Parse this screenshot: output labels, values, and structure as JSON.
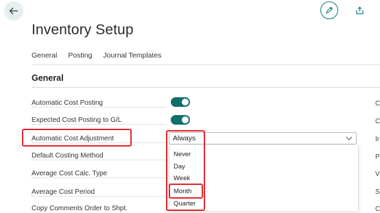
{
  "page": {
    "title": "Inventory Setup"
  },
  "nav": {
    "tabs": [
      "General",
      "Posting",
      "Journal Templates"
    ]
  },
  "section": {
    "title": "General"
  },
  "fields": {
    "automatic_cost_posting": {
      "label": "Automatic Cost Posting",
      "value": true
    },
    "expected_cost_posting": {
      "label": "Expected Cost Posting to G/L",
      "value": true
    },
    "automatic_cost_adjustment": {
      "label": "Automatic Cost Adjustment",
      "value": "Always"
    },
    "default_costing_method": {
      "label": "Default Costing Method"
    },
    "average_cost_calc_type": {
      "label": "Average Cost Calc. Type"
    },
    "average_cost_period": {
      "label": "Average Cost Period"
    },
    "copy_comments": {
      "label": "Copy Comments Order to Shpt."
    }
  },
  "dropdown": {
    "options": [
      "Never",
      "Day",
      "Week",
      "Month",
      "Quarter"
    ]
  },
  "right_column": {
    "letters": [
      "C",
      "C",
      "Ir",
      "P",
      "V",
      "S",
      "C"
    ]
  },
  "icons": {
    "back": "arrow-left-icon",
    "edit": "pencil-icon",
    "share": "share-icon",
    "chevron": "chevron-down-icon"
  },
  "colors": {
    "accent": "#0f6f6a",
    "highlight": "#e0262b"
  }
}
